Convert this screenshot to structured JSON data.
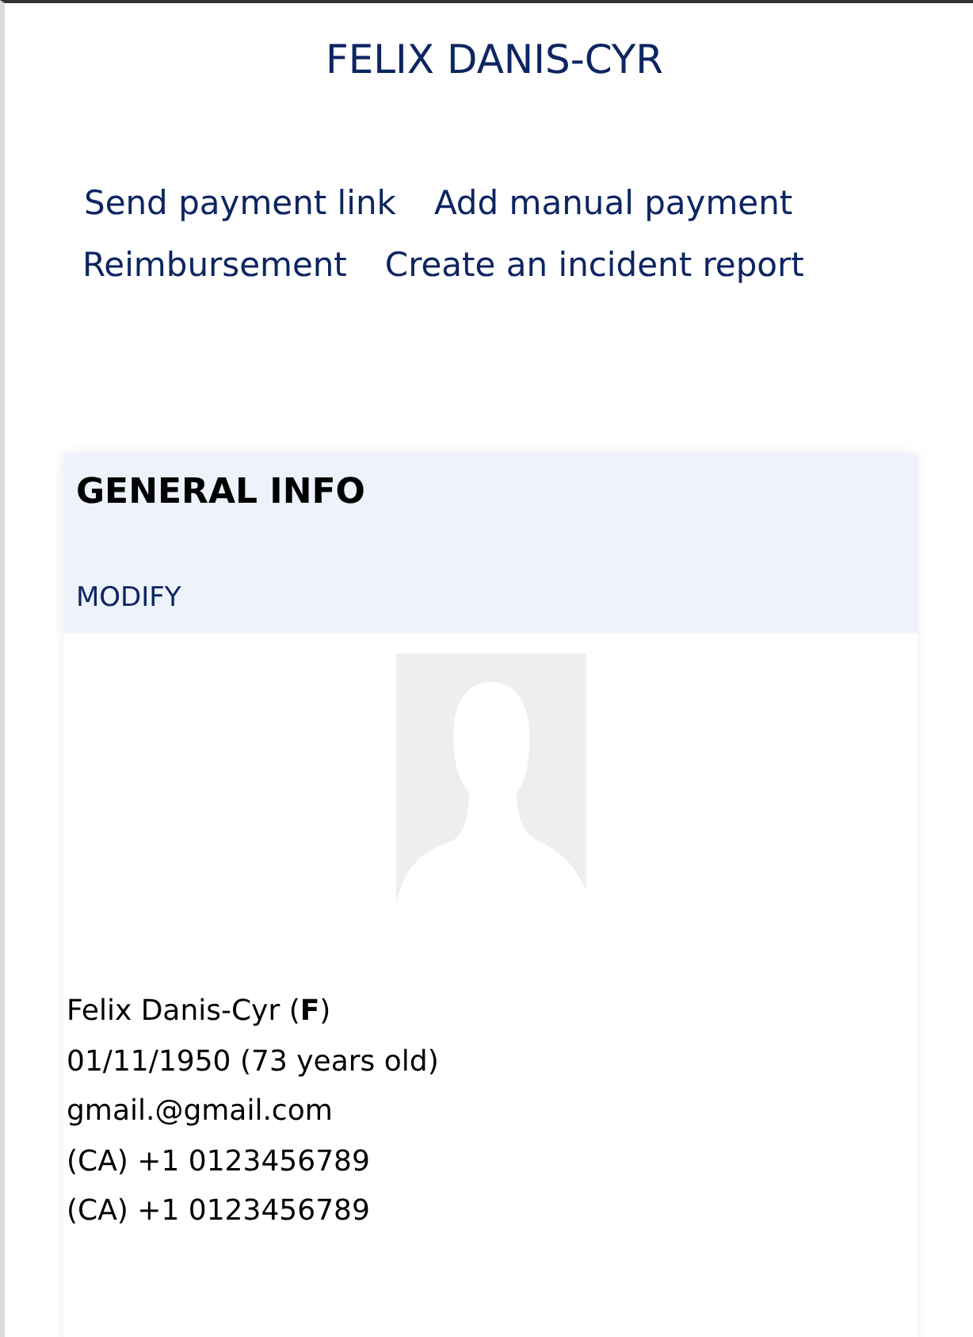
{
  "page_title": "FELIX DANIS-CYR",
  "actions": [
    "Send payment link",
    "Add manual payment",
    "Reimbursement",
    "Create an incident report"
  ],
  "card": {
    "title": "GENERAL INFO",
    "modify": "MODIFY",
    "lines": [
      "Felix Danis-Cyr (**F**)",
      "01/11/1950 (73 years old)",
      "gmail.@gmail.com",
      "(CA) +1 0123456789",
      "(CA) +1 0123456789"
    ]
  }
}
